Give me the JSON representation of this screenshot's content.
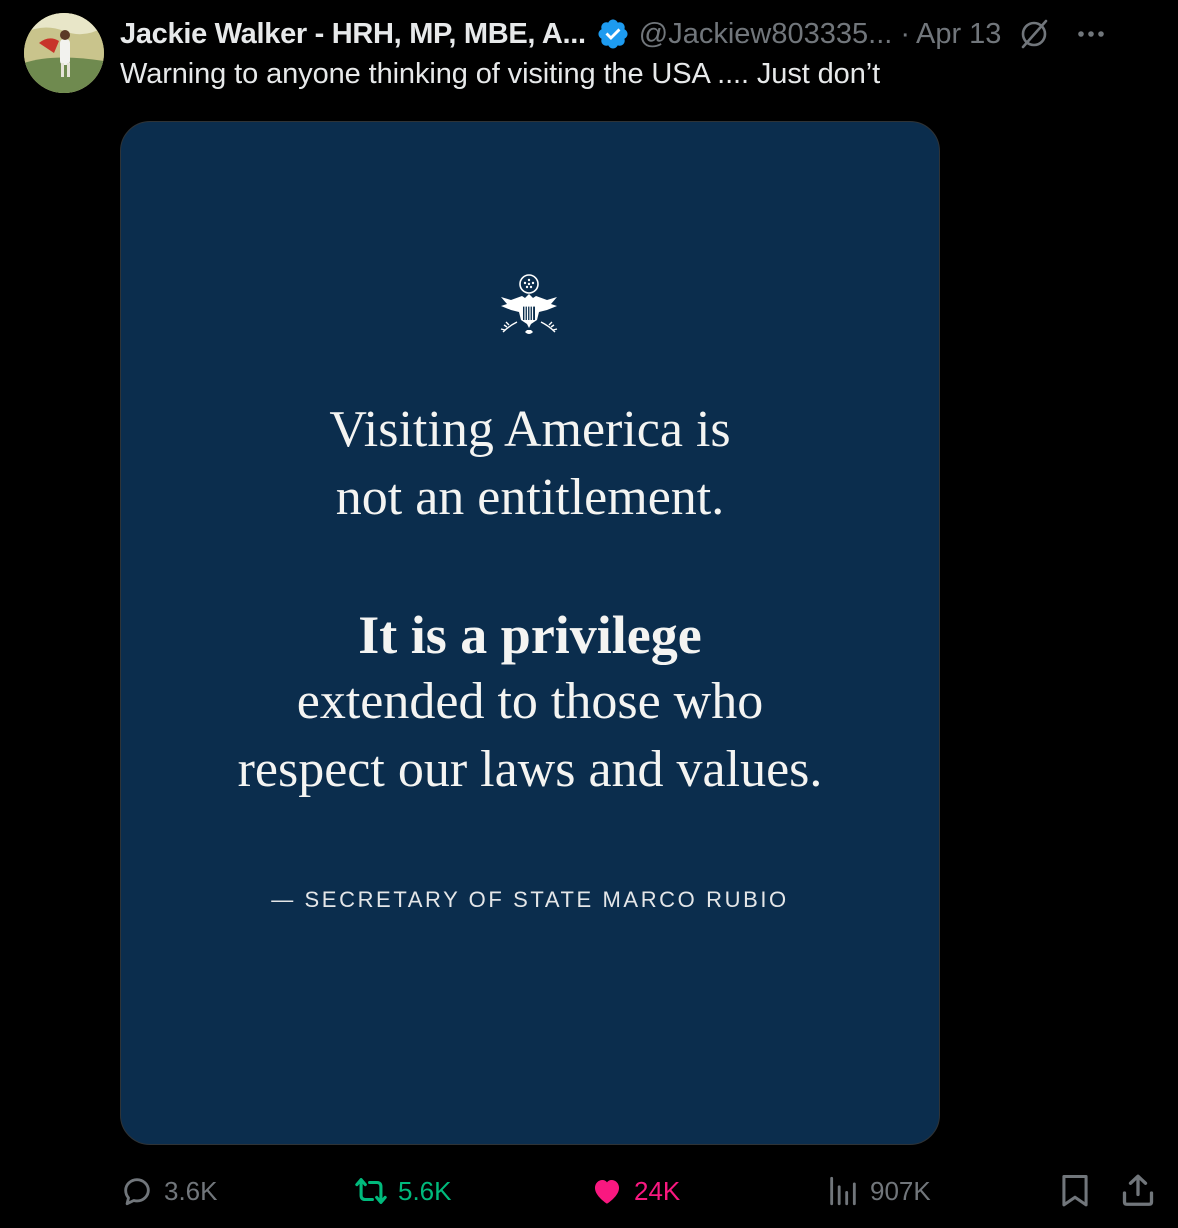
{
  "post": {
    "author_name": "Jackie Walker - HRH, MP, MBE, A...",
    "handle": "@Jackiew803335...",
    "separator": "·",
    "date": "Apr 13",
    "text": "Warning to anyone thinking of visiting the USA .... Just don’t",
    "verified_color": "#1d9bf0"
  },
  "media": {
    "background_color": "#0b2d4d",
    "quote_lines": [
      "Visiting America is",
      "not an entitlement.",
      "It is a privilege",
      "extended to those who",
      "respect our laws and values."
    ],
    "attribution": "— SECRETARY OF STATE MARCO RUBIO"
  },
  "actions": {
    "replies": "3.6K",
    "reposts": "5.6K",
    "likes": "24K",
    "views": "907K",
    "repost_color": "#00ba7c",
    "like_color": "#f91880",
    "muted_color": "#71767b"
  },
  "icons": [
    "verified-badge-icon",
    "grok-icon",
    "more-icon",
    "reply-icon",
    "retweet-icon",
    "heart-icon",
    "views-icon",
    "bookmark-icon",
    "share-icon",
    "state-department-seal"
  ]
}
